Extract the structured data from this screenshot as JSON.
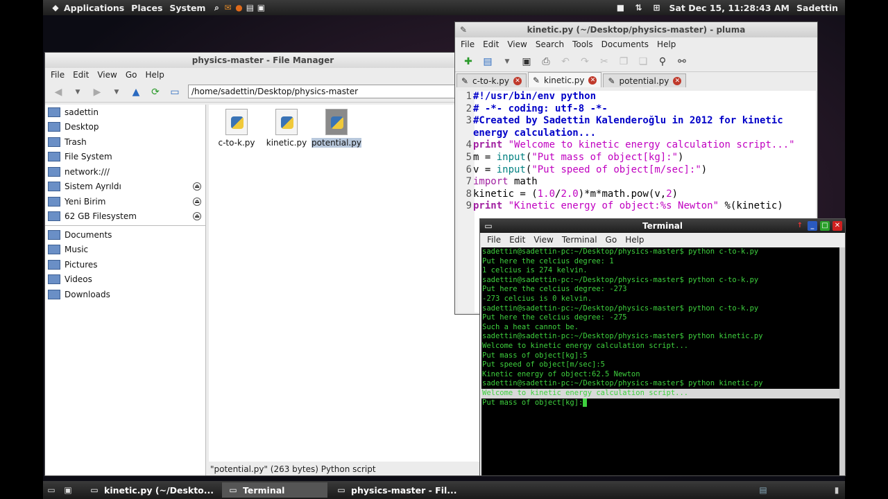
{
  "top_panel": {
    "menus": [
      "Applications",
      "Places",
      "System"
    ],
    "datetime": "Sat Dec 15, 11:28:43 AM",
    "user": "Sadettin"
  },
  "file_manager": {
    "title": "physics-master - File Manager",
    "menu": [
      "File",
      "Edit",
      "View",
      "Go",
      "Help"
    ],
    "location": "/home/sadettin/Desktop/physics-master",
    "sidebar_top": [
      {
        "label": "sadettin",
        "icon": "home-folder-icon"
      },
      {
        "label": "Desktop",
        "icon": "desktop-icon"
      },
      {
        "label": "Trash",
        "icon": "trash-icon"
      },
      {
        "label": "File System",
        "icon": "drive-icon"
      },
      {
        "label": "network:///",
        "icon": "network-icon"
      },
      {
        "label": "Sistem Ayrıldı",
        "icon": "drive-icon"
      },
      {
        "label": "Yeni Birim",
        "icon": "drive-icon"
      },
      {
        "label": "62 GB Filesystem",
        "icon": "drive-icon"
      }
    ],
    "sidebar_bookmarks": [
      {
        "label": "Documents",
        "icon": "folder-icon"
      },
      {
        "label": "Music",
        "icon": "music-folder-icon"
      },
      {
        "label": "Pictures",
        "icon": "pictures-folder-icon"
      },
      {
        "label": "Videos",
        "icon": "videos-folder-icon"
      },
      {
        "label": "Downloads",
        "icon": "downloads-folder-icon"
      }
    ],
    "files": [
      "c-to-k.py",
      "kinetic.py",
      "potential.py"
    ],
    "selected_file": "potential.py",
    "status": "\"potential.py\" (263 bytes) Python script"
  },
  "pluma": {
    "title": "kinetic.py (~/Desktop/physics-master) - pluma",
    "menu": [
      "File",
      "Edit",
      "View",
      "Search",
      "Tools",
      "Documents",
      "Help"
    ],
    "tabs": [
      "c-to-k.py",
      "kinetic.py",
      "potential.py"
    ],
    "active_tab": "kinetic.py",
    "line_numbers": [
      "1",
      "2",
      "3",
      "",
      "4",
      "5",
      "6",
      "7",
      "8",
      "9"
    ]
  },
  "terminal": {
    "title": "Terminal",
    "menu": [
      "File",
      "Edit",
      "View",
      "Terminal",
      "Go",
      "Help"
    ],
    "lines": [
      "sadettin@sadettin-pc:~/Desktop/physics-master$ python c-to-k.py",
      "Put here the celcius degree: 1",
      "1 celcius is 274 kelvin.",
      "sadettin@sadettin-pc:~/Desktop/physics-master$ python c-to-k.py",
      "Put here the celcius degree: -273",
      "-273 celcius is 0 kelvin.",
      "sadettin@sadettin-pc:~/Desktop/physics-master$ python c-to-k.py",
      "Put here the celcius degree: -275",
      "Such a heat cannot be.",
      "sadettin@sadettin-pc:~/Desktop/physics-master$ python kinetic.py",
      "Welcome to kinetic energy calculation script...",
      "Put mass of object[kg]:5",
      "Put speed of object[m/sec]:5",
      "Kinetic energy of object:62.5 Newton",
      "sadettin@sadettin-pc:~/Desktop/physics-master$ python kinetic.py",
      "Welcome to kinetic energy calculation script...",
      "Put mass of object[kg]:"
    ],
    "highlight_index": 15
  },
  "taskbar": [
    {
      "label": "kinetic.py (~/Deskto...",
      "icon": "text-editor-icon"
    },
    {
      "label": "Terminal",
      "icon": "terminal-icon"
    },
    {
      "label": "physics-master - Fil...",
      "icon": "folder-icon"
    }
  ]
}
